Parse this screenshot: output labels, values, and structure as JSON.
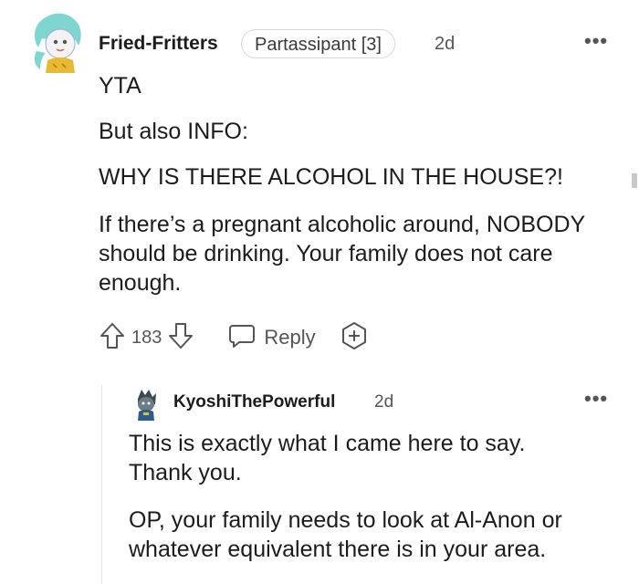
{
  "comment": {
    "username": "Fried-Fritters",
    "flair": "Partassipant [3]",
    "age": "2d",
    "more": "•••",
    "paragraphs": [
      "YTA",
      "But also INFO:",
      "WHY IS THERE ALCOHOL IN THE HOUSE?!",
      "If there’s a pregnant alcoholic around, NOBODY should be drinking. Your family does not care enough."
    ],
    "votes": "183",
    "reply_label": "Reply",
    "icons": [
      "upvote-icon",
      "downvote-icon",
      "reply-icon",
      "award-icon",
      "more-options-icon"
    ]
  },
  "reply": {
    "username": "KyoshiThePowerful",
    "age": "2d",
    "more": "•••",
    "paragraphs": [
      "This is exactly what I came here to say. Thank you.",
      "OP, your family needs to look at Al-Anon or whatever equivalent there is in your area."
    ]
  },
  "colors": {
    "text": "#1c1c1c",
    "meta": "#555555",
    "flair_border": "#d8d8d8",
    "thread_line": "#e6e6e6"
  }
}
